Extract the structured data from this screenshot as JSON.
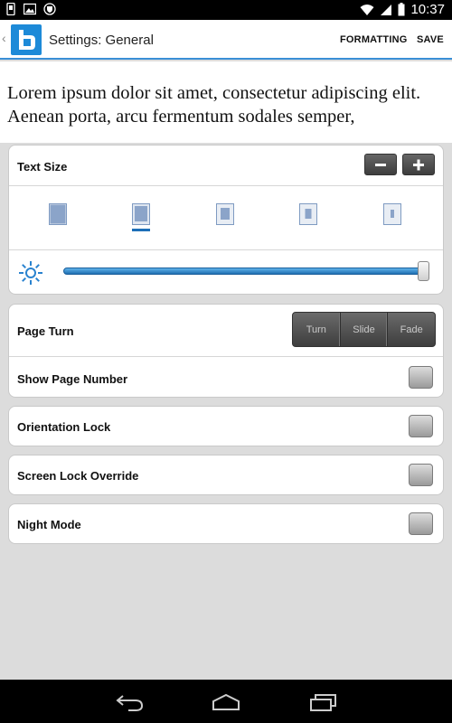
{
  "status_bar": {
    "time": "10:37"
  },
  "action_bar": {
    "title": "Settings: General",
    "formatting_label": "FORMATTING",
    "save_label": "SAVE"
  },
  "preview": {
    "text": "Lorem ipsum dolor sit amet, consectetur adipiscing elit. Aenean porta, arcu fermentum sodales semper,"
  },
  "text_size": {
    "label": "Text Size",
    "decrease_label": "−",
    "increase_label": "+",
    "selected_index": 1,
    "options_count": 5
  },
  "brightness": {
    "level_percent": 100
  },
  "page_turn": {
    "label": "Page Turn",
    "options": [
      "Turn",
      "Slide",
      "Fade"
    ]
  },
  "toggles": [
    {
      "label": "Show Page Number",
      "checked": false
    },
    {
      "label": "Orientation Lock",
      "checked": false
    },
    {
      "label": "Screen Lock Override",
      "checked": false
    },
    {
      "label": "Night Mode",
      "checked": false
    }
  ],
  "colors": {
    "accent": "#1d8ad8",
    "slider": "#2a83cf",
    "background": "#dcdcdc"
  }
}
